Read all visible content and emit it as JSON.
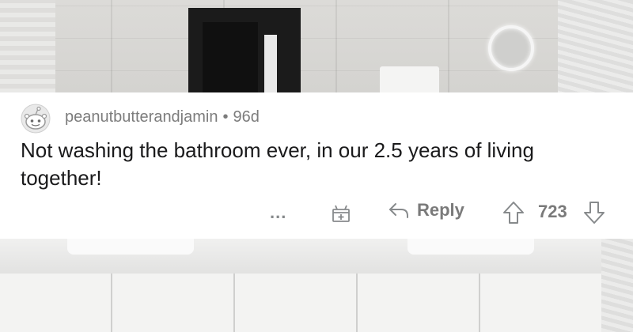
{
  "comment": {
    "username": "peanutbutterandjamin",
    "separator": "•",
    "age": "96d",
    "body": "Not washing the bathroom ever, in our 2.5 years of living together!",
    "more_label": "...",
    "reply_label": "Reply",
    "score": "723"
  },
  "icons": {
    "avatar": "snoo-avatar-icon",
    "award": "gift-award-icon",
    "reply": "reply-arrow-icon",
    "upvote": "upvote-arrow-icon",
    "downvote": "downvote-arrow-icon"
  },
  "colors": {
    "card_bg": "#ffffff",
    "text_primary": "#1a1a1b",
    "text_meta": "#7c7c7c",
    "icon_gray": "#878a8c"
  }
}
